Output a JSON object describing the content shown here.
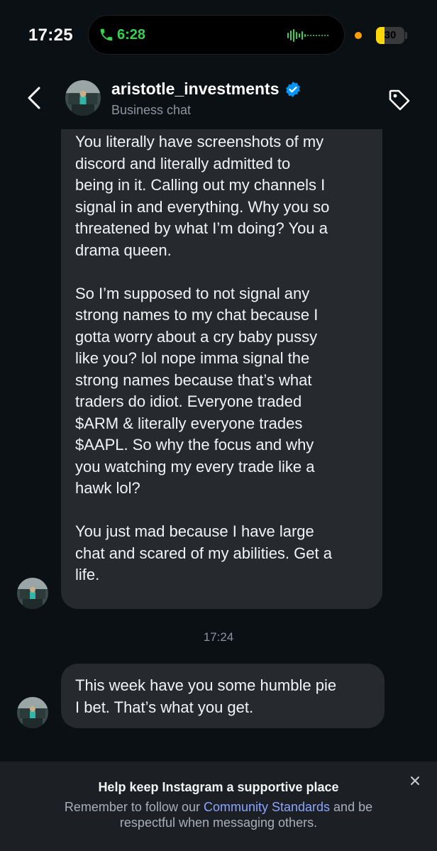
{
  "status_bar": {
    "time": "17:25",
    "call_timer": "6:28",
    "battery_level": "30",
    "battery_percent": 30,
    "accent_call": "#35d34f",
    "accent_battery": "#ffd60a"
  },
  "header": {
    "username": "aristotle_investments",
    "subtitle": "Business chat",
    "icons": [
      "chevron-left-icon",
      "verified-badge-icon",
      "tag-icon"
    ],
    "verified_color": "#0095f6"
  },
  "messages": [
    {
      "paragraphs": [
        "You literally have screenshots of my\ndiscord and literally admitted to\nbeing in it. Calling out my channels I\nsignal in and everything. Why you so\nthreatened by what I’m doing? You a\ndrama queen.",
        "So I’m supposed to not signal any\nstrong names to my chat because I\ngotta worry about a cry baby pussy\nlike you? lol nope imma signal the\nstrong names because that’s what\ntraders do idiot. Everyone traded\n$ARM & literally everyone trades\n$AAPL. So why the focus and why\nyou watching my every trade like a\nhawk lol?",
        "You just mad because I have large\nchat and scared of my abilities. Get a\nlife."
      ]
    },
    {
      "paragraphs": [
        "This week have you some humble pie\nI bet. That’s what you get."
      ]
    }
  ],
  "timestamp": "17:24",
  "notice": {
    "title": "Help keep Instagram a supportive place",
    "body_before": "Remember to follow our ",
    "link": "Community Standards",
    "body_after": " and be respectful when messaging others."
  }
}
